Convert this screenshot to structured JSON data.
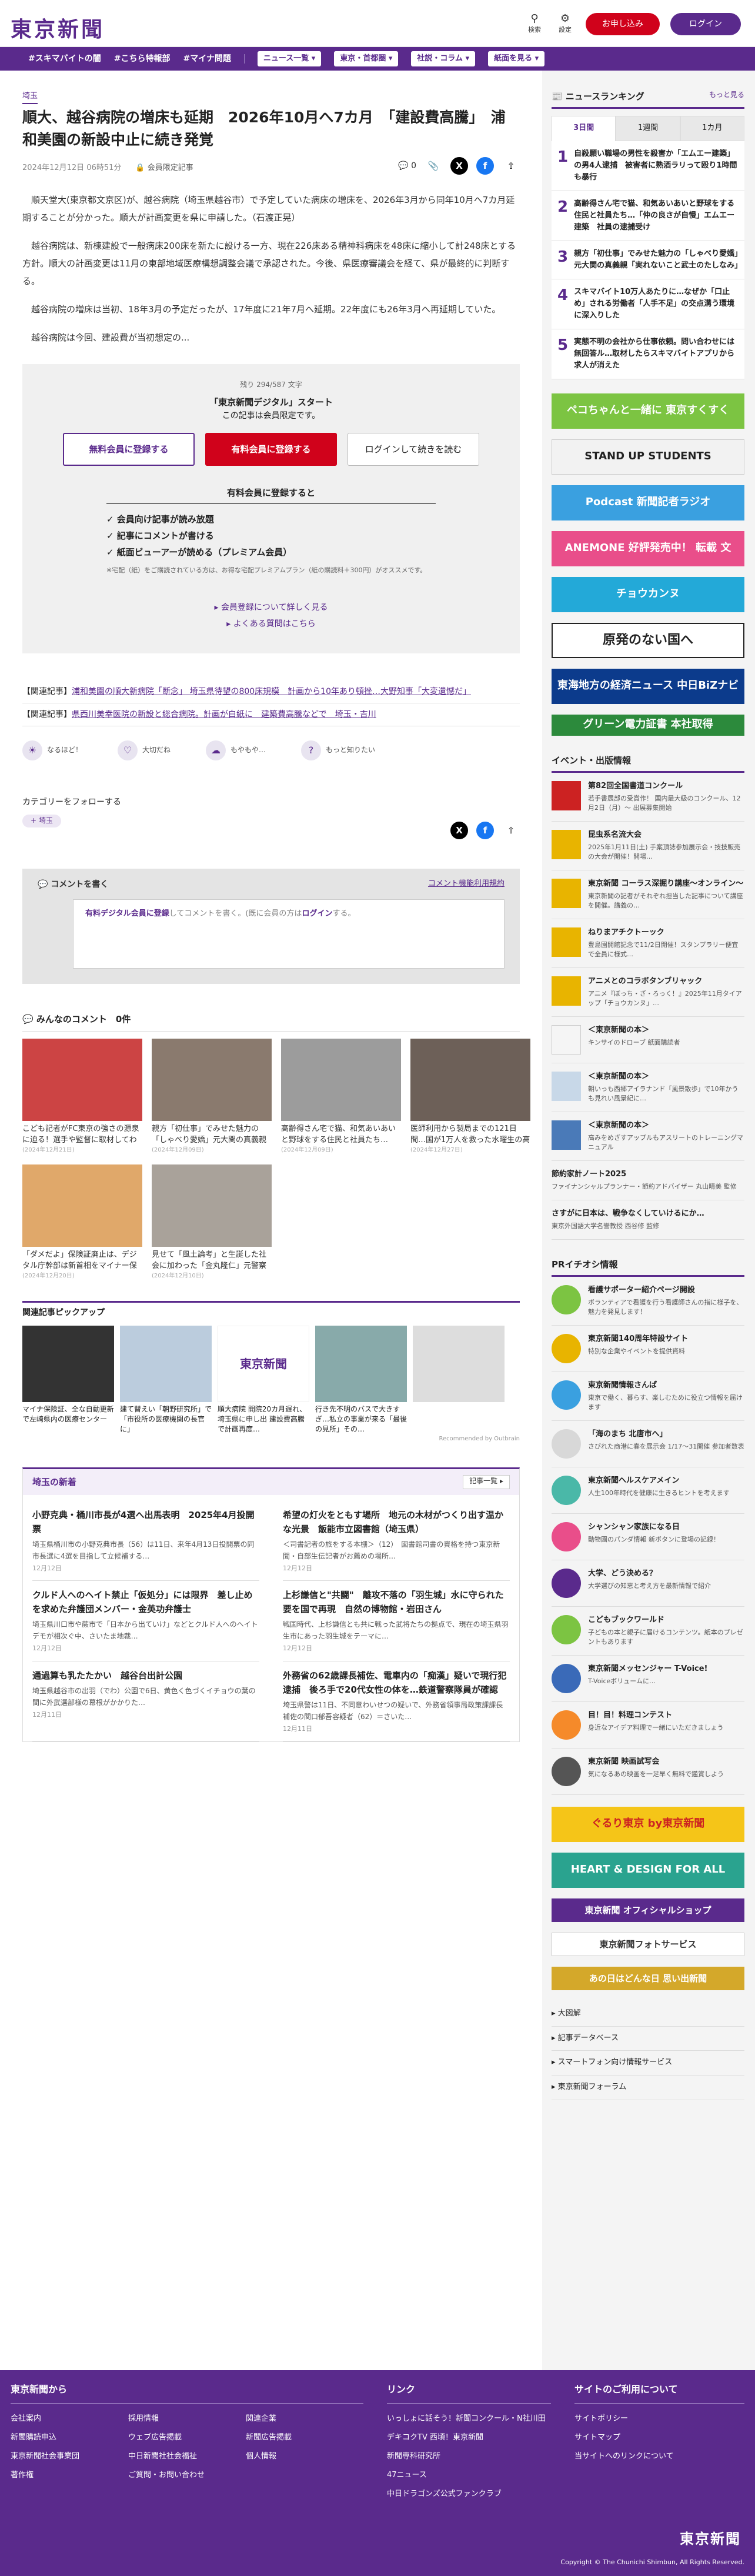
{
  "header": {
    "logo": "東京新聞",
    "search_label": "検索",
    "settings_label": "設定",
    "signup": "お申し込み",
    "login": "ログイン"
  },
  "nav": {
    "items": [
      "#スキマバイトの闇",
      "#こちら特報部",
      "#マイナ問題"
    ],
    "dropdowns": [
      "ニュース一覧",
      "東京・首都圏",
      "社説・コラム",
      "紙面を見る"
    ]
  },
  "article": {
    "category": "埼玉",
    "title": "順大、越谷病院の増床も延期　2026年10月へ7カ月　「建設費高騰」　浦和美園の新設中止に続き発覚",
    "date": "2024年12月12日 06時51分",
    "members_only": "会員限定記事",
    "comment_count": "0",
    "paragraphs": [
      "順天堂大(東京都文京区)が、越谷病院（埼玉県越谷市）で予定していた病床の増床を、2026年3月から同年10月へ7カ月延期することが分かった。順大が計画変更を県に申請した。（石渡正晃）",
      "越谷病院は、新棟建設で一般病床200床を新たに設ける一方、現在226床ある精神科病床を48床に縮小して計248床とする方針。順大の計画変更は11月の東部地域医療構想調整会議で承認された。今後、県医療審議会を経て、県が最終的に判断する。",
      "越谷病院の増床は当初、18年3月の予定だったが、17年度に21年7月へ延期。22年度にも26年3月へ再延期していた。",
      "越谷病院は今回、建設費が当初想定の..."
    ]
  },
  "paywall": {
    "remaining": "残り 294/587 文字",
    "title": "「東京新聞デジタル」スタート",
    "subtitle": "この記事は会員限定です。",
    "btn_free": "無料会員に登録する",
    "btn_paid": "有料会員に登録する",
    "btn_login": "ログインして続きを読む",
    "perks_title": "有料会員に登録すると",
    "perks": [
      "✓ 会員向け記事が読み放題",
      "✓ 記事にコメントが書ける",
      "✓ 紙面ビューアーが読める（プレミアム会員）"
    ],
    "note": "※宅配（紙）をご購読されている方は、お得な宅配プレミアムプラン（紙の購読料＋300円）がオススメです。",
    "link1": "会員登録について詳しく見る",
    "link2": "よくある質問はこちら"
  },
  "related": [
    {
      "label": "【関連記事】",
      "link": "浦和美園の順大新病院「断念」 埼玉県待望の800床規模　計画から10年あり頓挫…大野知事「大変遺憾だ」"
    },
    {
      "label": "【関連記事】",
      "link": "県西川美幸医院の新設と総合病院。計画が白紙に　建築費高騰などで　埼玉・吉川"
    }
  ],
  "reactions": [
    "なるほど！",
    "大切だね",
    "もやもや…",
    "もっと知りたい"
  ],
  "follow": {
    "title": "カテゴリーをフォローする",
    "tag": "埼玉"
  },
  "comment": {
    "title": "コメントを書く",
    "rule_link": "コメント機能利用規約",
    "placeholder_prefix": "有料デジタル会員に登録",
    "placeholder_mid": "してコメントを書く。(既に会員の方は",
    "placeholder_login": "ログイン",
    "placeholder_suffix": "する。"
  },
  "everyone_comments": {
    "title": "みんなのコメント　0件"
  },
  "cards": [
    {
      "t": "こども記者がFC東京の強さの源泉に迫る！選手や監督に取材してわかったことは？",
      "d": "(2024年12月21日)"
    },
    {
      "t": "親方「初仕事」でみせた魅力の「しゃべり愛嬌」元大関の真義親「実れないこと武士の…",
      "d": "(2024年12月09日)"
    },
    {
      "t": "高齢得さん宅で猫、和気あいあいと野球をする住民と社員たち…「仲の良さが自慢」エムエー…",
      "d": "(2024年12月09日)"
    },
    {
      "t": "医師利用から製局までの121日間…国が1万人を救った水曜生の高校受け手子…",
      "d": "(2024年12月27日)"
    },
    {
      "t": "「ダメだよ」保険証廃止は、デジタル庁幹部は新首相をマイナー保険証にする",
      "d": "(2024年12月20日)"
    },
    {
      "t": "見せて「風土論考」と生誕した社会に加わった「金丸隆仁」元警察庁官房長「死刑は必要」…",
      "d": "(2024年12月10日)"
    }
  ],
  "pickup": {
    "title": "関連記事ピックアップ",
    "items": [
      {
        "t": "マイナ保険証、全な自動更新で左崎県内の医療センター"
      },
      {
        "t": "建て替えい「朝野研究所」で「市役所の医療機関の長官に」"
      },
      {
        "t": "順大病院 開院20カ月遅れ、埼玉県に申し出 建設費高騰で計画再度…"
      },
      {
        "t": "行き先不明のバスで大きすぎ…私立の事業が来る「最後の見所」その…"
      },
      {
        "t": ""
      }
    ],
    "recommended": "Recommended by Outbrain"
  },
  "saitama": {
    "title": "埼玉の新着",
    "more": "記事一覧",
    "items": [
      {
        "t": "小野克典・桶川市長が4選へ出馬表明　2025年4月投開票",
        "x": "埼玉県桶川市の小野克典市長（56）は11日、来年4月13日投開票の同市長選に4選を目指して立候補する…",
        "d": "12月12日"
      },
      {
        "t": "希望の灯火をともす場所　地元の木材がつくり出す温かな光景　飯能市立図書館（埼玉県）",
        "x": "＜司書記者の旅をする本棚＞（12）　図書館司書の資格を持つ東京新聞・自部生伝記者がお薦めの場所…",
        "d": "12月12日"
      },
      {
        "t": "クルド人へのヘイト禁止「仮処分」には限界　差し止めを求めた弁護団メンバー・金英功弁護士",
        "x": "埼玉県川口市や蕨市で「日本から出ていけ」などとクルド人へのヘイトデモが相次ぐ中、さいたま地裁…",
        "d": "12月12日"
      },
      {
        "t": "上杉謙信と\"共闘\"　離攻不落の「羽生城」水に守られた要を国で再現　自然の博物館・岩田さん",
        "x": "戦国時代、上杉謙信とも共に戦った武将たちの拠点で、現在の埼玉県羽生市にあった羽生城をテーマに…",
        "d": "12月12日"
      },
      {
        "t": "通過算も乳たたかい　越谷台出計公園",
        "x": "埼玉県越谷市の出羽（でわ）公園で6日、黄色く色づくイチョウの葉の間に外武選部様の幕根がかかりた…",
        "d": "12月11日"
      },
      {
        "t": "外務省の62歳課長補佐、電車内の「痴漢」疑いで現行犯逮捕　後ろ手で20代女性の体を…鉄道警察隊員が確認",
        "x": "埼玉県警は11日、不同意わいせつの疑いで、外務省領事局政策課課長補佐の関口郁吾容疑者（62）＝さいた…",
        "d": "12月11日"
      }
    ]
  },
  "ranking": {
    "title": "ニュースランキング",
    "more": "もっと見る",
    "tabs": [
      "3日間",
      "1週間",
      "1カ月"
    ],
    "items": [
      "自殺願い職場の男性を殺害か「エムエー建築」の男4人逮捕　被害者に熟酒ラリって殴り1時間も暴行",
      "高齢得さん宅で猫、和気あいあいと野球をする住民と社員たち…「仲の良さが自慢」エムエー建築　社員の逮捕受け",
      "親方「初仕事」でみせた魅力の「しゃべり愛嬌」元大関の真義親「実れないこと武士のたしなみ」",
      "スキマバイト10万人あたりに…なぜか「口止め」される労働者「人手不足」の交点溝う環境に深入りした",
      "実態不明の会社から仕事依頼。問い合わせには無回答ル…取材したらスキマバイトアプリから求人が消えた"
    ]
  },
  "banners": [
    {
      "label": "ペコちゃんと一緒に 東京すくすく",
      "color": "#7cc442"
    },
    {
      "label": "STAND UP STUDENTS",
      "color": "#f2f2f2"
    },
    {
      "label": "Podcast 新聞記者ラジオ",
      "color": "#3aa0e0"
    },
    {
      "label": "ANEMONE 好評発売中！ 転載 文",
      "color": "#e94e8a"
    },
    {
      "label": "チョウカンヌ",
      "color": "#23a9d8"
    },
    {
      "label": "原発のない国へ",
      "color": "#ffffff"
    },
    {
      "label": "東海地方の経済ニュース 中日BiZナビ",
      "color": "#0c3b8c"
    },
    {
      "label": "グリーン電力証書 本社取得",
      "color": "#2c8a3c"
    }
  ],
  "events": {
    "title": "イベント・出版情報",
    "items": [
      {
        "t": "第82回全国書道コンクール",
        "x": "若手書展部の受賞作！ 国内最大級のコンクール、12月2日（月）～ 出展募集開始"
      },
      {
        "t": "昆虫系名流大会",
        "x": "2025年1月11日(土) 手案頂誌参加展示会・技技販売の大会が開催！開場…"
      },
      {
        "t": "東京新聞 コーラス深掘り講座～オンライン～",
        "x": "東京新聞の記者がそれぞれ担当した記事について講座を開催。講義の…"
      },
      {
        "t": "ねりまアチクトーック",
        "x": "豊島園開館記念で11/2日開催！スタンプラリー便宜で全員に様式…"
      },
      {
        "t": "アニメとのコラボタンブリャック",
        "x": "アニメ『ぼっち・ざ・ろっく！』2025年11月タイアップ「チョウカンヌ」…"
      },
      {
        "t": "＜東京新聞の本＞",
        "x": "キンサイのドローブ 紙面購読者"
      },
      {
        "t": "＜東京新聞の本＞",
        "x": "朝いっも西郷アイラナンド「風景散歩」で10年かうも見れい風景紀に…"
      },
      {
        "t": "＜東京新聞の本＞",
        "x": "高みをめざすアップルもアスリートのトレーニングマニュアル"
      },
      {
        "t": "節約家計ノート2025",
        "x": "ファイナンシャルプランナー・節約アドバイザー 丸山晴美 監修"
      },
      {
        "t": "さすがに日本は、戦争なくしていけるにか…",
        "x": "東京外国語大学名誉教授 西谷修 監修"
      }
    ]
  },
  "pr": {
    "title": "PRイチオシ情報",
    "items": [
      {
        "t": "看護サポーター紹介ページ開設",
        "x": "ボランティアで看護を行う看護師さんの指に様子を、魅力を発見します！"
      },
      {
        "t": "東京新聞140周年特設サイト",
        "x": "特別な企業やイベントを提供資料"
      },
      {
        "t": "東京新聞情報さんぱ",
        "x": "東京で働く、暮らす、楽しむために役立つ情報を届けます"
      },
      {
        "t": "「海のまち 北唐市へ」",
        "x": "さびれた商港に春を展示会 1/17～31開催 参加者数表"
      },
      {
        "t": "東京新聞ヘルスケアメイン",
        "x": "人生100年時代を健康に生きるヒントを考えます"
      },
      {
        "t": "シャンシャン家族になる日",
        "x": "動物園のパンダ情報 新ボタンに登場の記録！"
      },
      {
        "t": "大学、どう決める？",
        "x": "大学選びの知恵と考え方を最新情報で紹介"
      },
      {
        "t": "こどもブックワールド",
        "x": "子どもの本と親子に届けるコンテンツ。紙本のプレゼントもあります"
      },
      {
        "t": "東京新聞メッセンジャー T-Voice!",
        "x": "T-Voiceボリュームに…"
      },
      {
        "t": "目！目！料理コンテスト",
        "x": "身近なアイデア料理で一緒にいただきましょう"
      },
      {
        "t": "東京新聞 映画試写会",
        "x": "気になるあの映画を一足早く無料で鑑賞しよう"
      }
    ]
  },
  "side_banners2": [
    {
      "label": "ぐるり東京 by東京新聞",
      "color": "#f5c518"
    },
    {
      "label": "HEART & DESIGN FOR ALL",
      "color": "#2aa38f"
    },
    {
      "label": "東京新聞 オフィシャルショップ",
      "color": "#5a2a8c"
    },
    {
      "label": "東京新聞フォトサービス",
      "color": "#ffffff"
    },
    {
      "label": "あの日はどんな日 思い出新聞",
      "color": "#d4a82a"
    }
  ],
  "side_links": [
    "大図解",
    "記事データベース",
    "スマートフォン向け情報サービス",
    "東京新聞フォーラム"
  ],
  "footer": {
    "col1_title": "東京新聞から",
    "col1": [
      "会社案内",
      "採用情報",
      "関連企業",
      "新聞購読申込",
      "ウェブ広告掲載",
      "新聞広告掲載",
      "東京新聞社会事業団",
      "中日新聞社社会福祉",
      "個人情報",
      "著作権",
      "ご質問・お問い合わせ"
    ],
    "col2_title": "リンク",
    "col2": [
      "いっしょに話そう！新聞コンクール・N社川田",
      "デキコクTV 西頃！東京新聞",
      "新聞専科研究所",
      "47ニュース",
      "中日ドラゴンズ公式ファンクラブ"
    ],
    "col3_title": "サイトのご利用について",
    "col3": [
      "サイトポリシー",
      "サイトマップ",
      "当サイトへのリンクについて"
    ],
    "logo": "東京新聞",
    "copyright": "Copyright © The Chunichi Shimbun, All Rights Reserved."
  },
  "colors": {
    "brand": "#5a2a8c",
    "accent_red": "#d0021b"
  }
}
